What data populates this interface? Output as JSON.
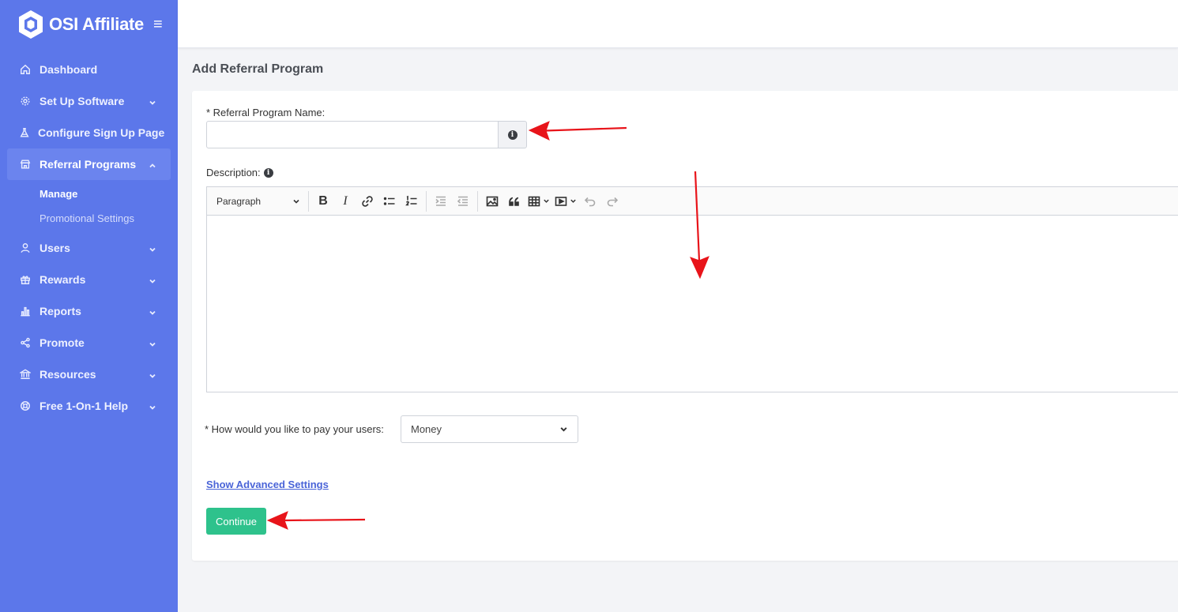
{
  "app": {
    "brand_name": "OSI Affiliate"
  },
  "sidebar": {
    "items": [
      {
        "label": "Dashboard",
        "icon": "home-icon",
        "has_chevron": false
      },
      {
        "label": "Set Up Software",
        "icon": "gear-icon",
        "has_chevron": true
      },
      {
        "label": "Configure Sign Up Page",
        "icon": "flask-icon",
        "has_chevron": false
      },
      {
        "label": "Referral Programs",
        "icon": "store-icon",
        "has_chevron": true,
        "active": true
      },
      {
        "label": "Users",
        "icon": "user-icon",
        "has_chevron": true
      },
      {
        "label": "Rewards",
        "icon": "gift-icon",
        "has_chevron": true
      },
      {
        "label": "Reports",
        "icon": "bar-chart-icon",
        "has_chevron": true
      },
      {
        "label": "Promote",
        "icon": "share-icon",
        "has_chevron": true
      },
      {
        "label": "Resources",
        "icon": "bank-icon",
        "has_chevron": true
      },
      {
        "label": "Free 1-On-1 Help",
        "icon": "lifebuoy-icon",
        "has_chevron": true
      }
    ],
    "subitems": [
      {
        "label": "Manage",
        "current": true
      },
      {
        "label": "Promotional Settings",
        "current": false
      }
    ]
  },
  "page": {
    "title": "Add Referral Program"
  },
  "form": {
    "name_label": "* Referral Program Name:",
    "name_value": "",
    "description_label": "Description:",
    "editor": {
      "block_format": "Paragraph"
    },
    "pay_label": "* How would you like to pay your users:",
    "pay_value": "Money",
    "advanced_link": "Show Advanced Settings",
    "continue_label": "Continue"
  },
  "colors": {
    "sidebar_bg": "#5c77ea",
    "continue_button": "#2ec28c",
    "link": "#4a64d8",
    "annotation_arrow": "#e8141a"
  }
}
